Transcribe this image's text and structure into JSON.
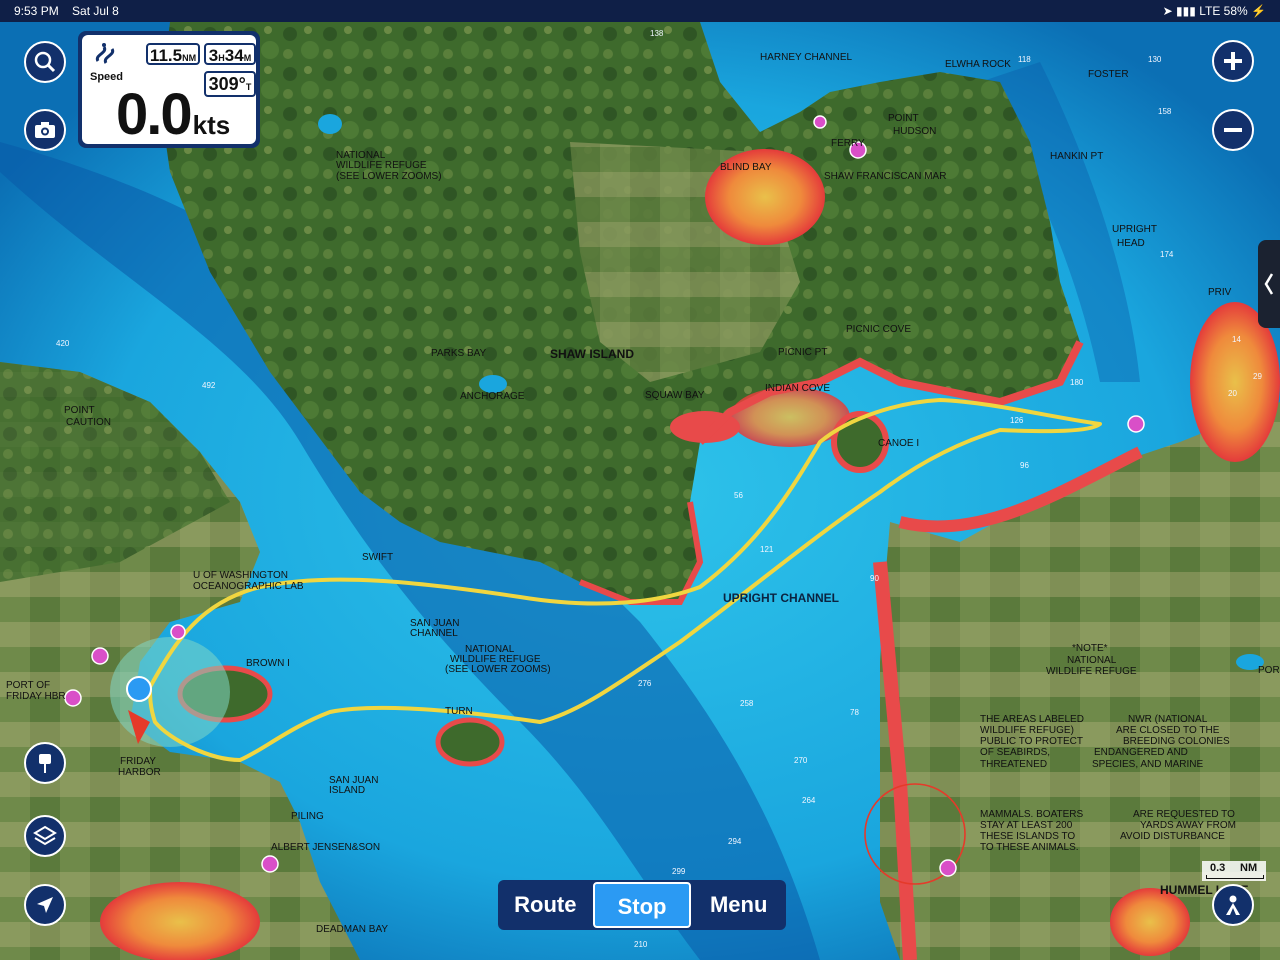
{
  "status_bar": {
    "time": "9:53 PM",
    "date": "Sat Jul 8",
    "carrier": "LTE",
    "battery": "58%"
  },
  "instrument_panel": {
    "distance_value": "11.5",
    "distance_unit": "NM",
    "time_hours": "3",
    "time_hours_unit": "H",
    "time_minutes": "34",
    "time_minutes_unit": "M",
    "speed_label": "Speed",
    "speed_value": "0.0",
    "speed_unit": "kts",
    "heading_value": "309°",
    "heading_ref": "T"
  },
  "bottom_bar": {
    "route_label": "Route",
    "stop_label": "Stop",
    "menu_label": "Menu"
  },
  "scale": {
    "value": "0.3",
    "unit": "NM"
  },
  "colors": {
    "panel": "#12306b",
    "active": "#2b9af3",
    "track": "#f0d640",
    "deep_water": "#0ea3dc",
    "shallow": "#e84a4a"
  },
  "icons": {
    "search": "search-icon",
    "camera": "camera-icon",
    "zoom_in": "plus-icon",
    "zoom_out": "minus-icon",
    "waypoint": "pin-icon",
    "layers": "layers-icon",
    "locate": "navigation-arrow-icon",
    "profile": "person-icon"
  },
  "map_labels": {
    "harney_channel": "HARNEY CHANNEL",
    "elwha_rock": "ELWHA ROCK",
    "foster": "FOSTER",
    "point_hudson_1": "POINT",
    "point_hudson_2": "HUDSON",
    "blind_bay": "BLIND BAY",
    "ferry": "FERRY",
    "shaw_franciscan": "SHAW FRANCISCAN MAR",
    "hankin_pt": "HANKIN PT",
    "upright_head_1": "UPRIGHT",
    "upright_head_2": "HEAD",
    "priv": "PRIV",
    "nwr_1": "NATIONAL",
    "nwr_2": "WILDLIFE REFUGE",
    "nwr_3": "(SEE LOWER ZOOMS)",
    "parks_bay": "PARKS BAY",
    "shaw_island": "SHAW ISLAND",
    "anchorage": "ANCHORAGE",
    "picnic_cove": "PICNIC COVE",
    "picnic_pt": "PICNIC PT",
    "indian_cove": "INDIAN COVE",
    "squaw_bay": "SQUAW BAY",
    "canoe_i": "CANOE I",
    "point_caution_1": "POINT",
    "point_caution_2": "CAUTION",
    "upright_channel": "UPRIGHT CHANNEL",
    "swift": "SWIFT",
    "uw_lab_1": "U OF WASHINGTON",
    "uw_lab_2": "OCEANOGRAPHIC LAB",
    "san_juan_channel_1": "SAN JUAN",
    "san_juan_channel_2": "CHANNEL",
    "brown_i": "BROWN I",
    "turn": "TURN",
    "port_of_friday_1": "PORT OF",
    "port_of_friday_2": "FRIDAY HBR",
    "friday_harbor_1": "FRIDAY",
    "friday_harbor_2": "HARBOR",
    "san_juan_island_1": "SAN JUAN",
    "san_juan_island_2": "ISLAND",
    "piling": "PILING",
    "albert_jensen": "ALBERT JENSEN&SON",
    "deadman_bay": "DEADMAN BAY",
    "note_1": "*NOTE*",
    "note_2": "NATIONAL",
    "note_3": "WILDLIFE REFUGE",
    "areas_1": "THE AREAS LABELED",
    "areas_2": "WILDLIFE REFUGE)",
    "areas_3": "PUBLIC TO PROTECT",
    "areas_4": "OF SEABIRDS,",
    "areas_5": "THREATENED",
    "nwr_note_1": "NWR (NATIONAL",
    "nwr_note_2": "ARE CLOSED TO THE",
    "nwr_note_3": "BREEDING COLONIES",
    "nwr_note_4": "ENDANGERED AND",
    "nwr_note_5": "SPECIES, AND MARINE",
    "mammals_1": "MAMMALS. BOATERS",
    "mammals_2": "STAY AT LEAST 200",
    "mammals_3": "THESE ISLANDS TO",
    "mammals_4": "TO THESE ANIMALS.",
    "requested_1": "ARE REQUESTED TO",
    "requested_2": "YARDS AWAY FROM",
    "requested_3": "AVOID DISTURBANCE",
    "hummel": "HUMMEL LAKE",
    "por": "POR"
  },
  "depth_soundings": [
    "138",
    "118",
    "158",
    "130",
    "174",
    "420",
    "492",
    "56",
    "121",
    "126",
    "96",
    "180",
    "276",
    "258",
    "78",
    "270",
    "264",
    "294",
    "299",
    "90",
    "14",
    "20",
    "29",
    "210"
  ]
}
